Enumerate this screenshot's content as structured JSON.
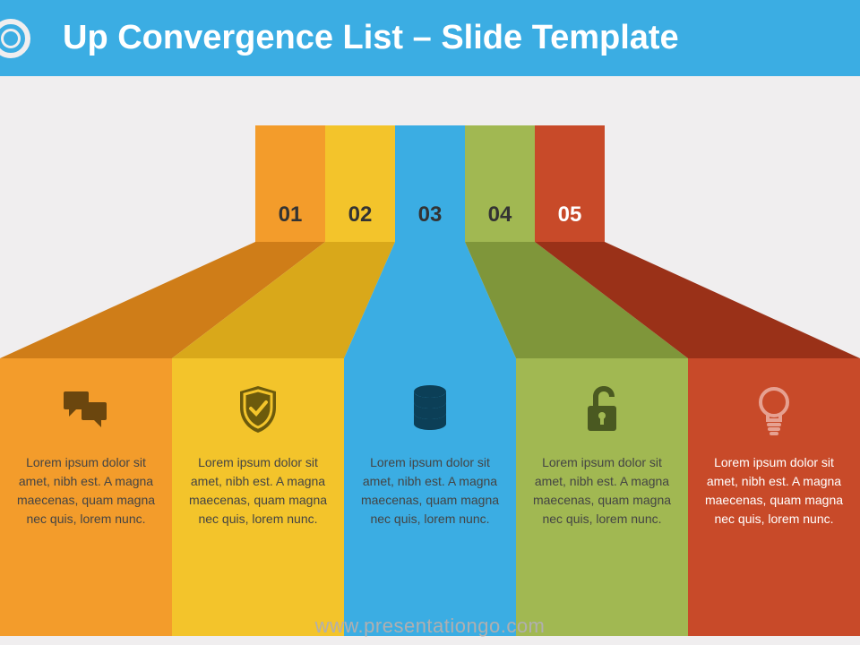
{
  "title": "Up Convergence List – Slide Template",
  "watermark": "www.presentationgo.com",
  "columns": [
    {
      "num": "01",
      "bar_color": "#f39c2b",
      "bar_dark": "#cf7d18",
      "panel_color": "#f39c2b",
      "icon": "chat-icon",
      "icon_color": "#6b460e",
      "num_color": "#333333",
      "text": "Lorem ipsum dolor sit amet, nibh est. A magna maecenas, quam magna nec quis, lorem nunc."
    },
    {
      "num": "02",
      "bar_color": "#f3c42b",
      "bar_dark": "#d9a81a",
      "panel_color": "#f3c42b",
      "icon": "shield-icon",
      "icon_color": "#6c5a0c",
      "num_color": "#333333",
      "text": "Lorem ipsum dolor sit amet, nibh est. A magna maecenas, quam magna nec quis, lorem nunc."
    },
    {
      "num": "03",
      "bar_color": "#3bade3",
      "bar_dark": "#2a8ab8",
      "panel_color": "#3bade3",
      "icon": "database-icon",
      "icon_color": "#0c3f57",
      "num_color": "#333333",
      "text": "Lorem ipsum dolor sit amet, nibh est. A magna maecenas, quam magna nec quis, lorem nunc."
    },
    {
      "num": "04",
      "bar_color": "#a1b852",
      "bar_dark": "#7f963a",
      "panel_color": "#a1b852",
      "icon": "lock-icon",
      "icon_color": "#4a5921",
      "num_color": "#333333",
      "text": "Lorem ipsum dolor sit amet, nibh est. A magna maecenas, quam magna nec quis, lorem nunc."
    },
    {
      "num": "05",
      "bar_color": "#c84a29",
      "bar_dark": "#9a3118",
      "panel_color": "#c84a29",
      "icon": "bulb-icon",
      "icon_color": "#e6a191",
      "num_color": "#ffffff",
      "text": "Lorem ipsum dolor sit amet, nibh est. A magna maecenas, quam magna nec quis, lorem nunc.",
      "text_color": "#ffffff"
    }
  ]
}
